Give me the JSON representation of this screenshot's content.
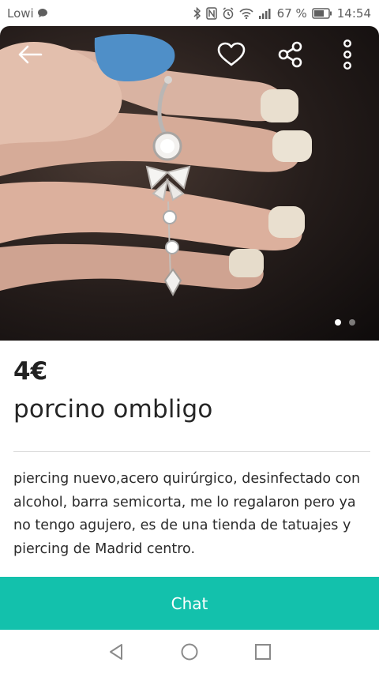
{
  "status_bar": {
    "carrier": "Lowi",
    "battery": "67 %",
    "time": "14:54"
  },
  "listing": {
    "price": "4€",
    "title": "porcino ombligo",
    "description": "piercing nuevo,acero quirúrgico, desinfectado con alcohol, barra semicorta, me lo regalaron pero ya no tengo agujero, es de una tienda de tatuajes y piercing de Madrid centro."
  },
  "gallery": {
    "image_count": 2,
    "active_index": 0
  },
  "actions": {
    "chat_label": "Chat"
  },
  "icons": {
    "back": "arrow-left-icon",
    "favorite": "heart-icon",
    "share": "share-icon",
    "more": "more-vertical-icon"
  },
  "colors": {
    "accent": "#13c1ac",
    "text": "#252525"
  }
}
